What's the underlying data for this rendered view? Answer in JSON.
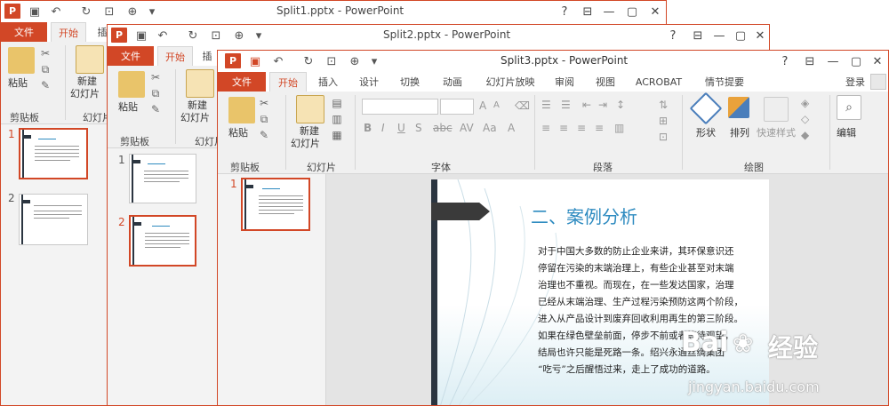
{
  "windows": [
    {
      "title": "Split1.pptx - PowerPoint",
      "file_tab": "文件",
      "home_tab": "开始",
      "insert_tab_partial": "插",
      "paste": "粘贴",
      "new_slide_1": "新建",
      "new_slide_2": "幻灯片",
      "clipboard": "剪贴板",
      "slides_group_partial": "幻灯片"
    },
    {
      "title": "Split2.pptx - PowerPoint",
      "file_tab": "文件",
      "home_tab": "开始",
      "insert_tab_partial": "插",
      "paste": "粘贴",
      "new_slide_1": "新建",
      "new_slide_2": "幻灯片",
      "clipboard": "剪贴板",
      "slides_group_partial": "幻灯片"
    },
    {
      "title": "Split3.pptx - PowerPoint",
      "tabs": [
        "文件",
        "开始",
        "插入",
        "设计",
        "切换",
        "动画",
        "幻灯片放映",
        "审阅",
        "视图",
        "ACROBAT",
        "情节提要"
      ],
      "login": "登录",
      "paste": "粘贴",
      "new_slide_1": "新建",
      "new_slide_2": "幻灯片",
      "groups": {
        "clipboard": "剪贴板",
        "slides": "幻灯片",
        "font": "字体",
        "paragraph": "段落",
        "drawing": "绘图"
      },
      "shape": "形状",
      "arrange": "排列",
      "quick_styles": "快速样式",
      "edit": "编辑"
    }
  ],
  "thumbnails": {
    "win1": [
      {
        "num": "1"
      },
      {
        "num": "2"
      }
    ],
    "win2": [
      {
        "num": "1"
      },
      {
        "num": "2"
      }
    ],
    "win3": [
      {
        "num": "1"
      }
    ]
  },
  "slide": {
    "title": "二、案例分析",
    "body": [
      "对于中国大多数的防止企业来讲，其环保意识还",
      "停留在污染的末端治理上，有些企业甚至对末端",
      "治理也不重视。而现在，在一些发达国家，治理",
      "已经从末端治理、生产过程污染预防这两个阶段，",
      "进入从产品设计到废弃回收利用再生的第三阶段。",
      "如果在绿色壁垒前面，停步不前或者等待观望，",
      "结局也许只能是死路一条。绍兴永通丝绸集团",
      "“吃亏”之后醒悟过来，走上了成功的道路。"
    ]
  },
  "watermark": {
    "brand": "经验",
    "url": "jingyan.baidu.com",
    "logo_text": "Bai"
  },
  "colors": {
    "accent": "#d24726",
    "slide_title": "#2e8bc0",
    "dark_band": "#2b3540"
  }
}
